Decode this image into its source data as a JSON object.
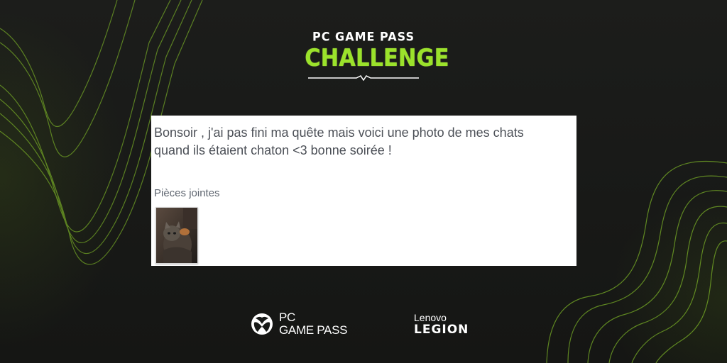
{
  "logo": {
    "line1": "PC GAME PASS",
    "line2": "CHALLENGE",
    "accent_color": "#9be22b"
  },
  "post": {
    "message_line1": "Bonsoir , j'ai pas fini ma quête mais voici une photo de mes chats",
    "message_line2": "quand ils étaient chaton <3 bonne soirée !",
    "attachments_label": "Pièces jointes",
    "attachment_thumbnail_icon": "cat-photo"
  },
  "footer": {
    "gamepass_line1": "PC",
    "gamepass_line2": "GAME PASS",
    "gamepass_icon": "xbox-icon",
    "lenovo": "Lenovo",
    "legion": "LEGION"
  },
  "colors": {
    "background": "#181a18",
    "line_accent": "#8fd12a",
    "text_gray": "#4c5057"
  }
}
